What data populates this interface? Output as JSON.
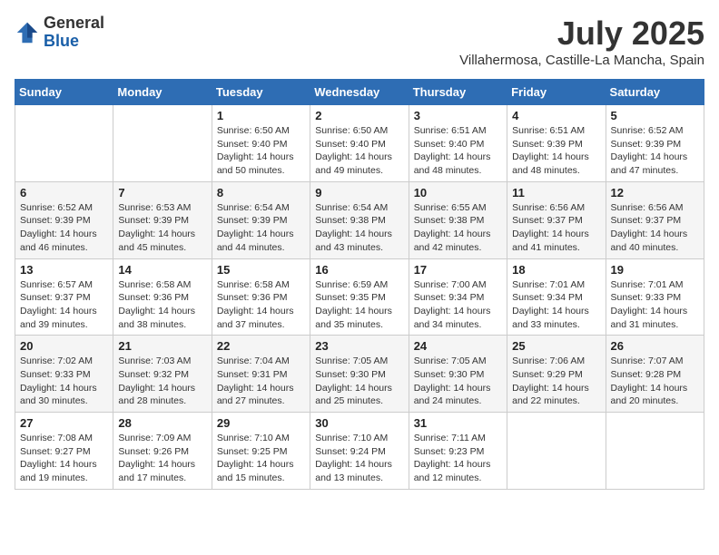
{
  "logo": {
    "general": "General",
    "blue": "Blue"
  },
  "title": "July 2025",
  "subtitle": "Villahermosa, Castille-La Mancha, Spain",
  "days_of_week": [
    "Sunday",
    "Monday",
    "Tuesday",
    "Wednesday",
    "Thursday",
    "Friday",
    "Saturday"
  ],
  "weeks": [
    [
      {
        "num": "",
        "detail": ""
      },
      {
        "num": "",
        "detail": ""
      },
      {
        "num": "1",
        "detail": "Sunrise: 6:50 AM\nSunset: 9:40 PM\nDaylight: 14 hours and 50 minutes."
      },
      {
        "num": "2",
        "detail": "Sunrise: 6:50 AM\nSunset: 9:40 PM\nDaylight: 14 hours and 49 minutes."
      },
      {
        "num": "3",
        "detail": "Sunrise: 6:51 AM\nSunset: 9:40 PM\nDaylight: 14 hours and 48 minutes."
      },
      {
        "num": "4",
        "detail": "Sunrise: 6:51 AM\nSunset: 9:39 PM\nDaylight: 14 hours and 48 minutes."
      },
      {
        "num": "5",
        "detail": "Sunrise: 6:52 AM\nSunset: 9:39 PM\nDaylight: 14 hours and 47 minutes."
      }
    ],
    [
      {
        "num": "6",
        "detail": "Sunrise: 6:52 AM\nSunset: 9:39 PM\nDaylight: 14 hours and 46 minutes."
      },
      {
        "num": "7",
        "detail": "Sunrise: 6:53 AM\nSunset: 9:39 PM\nDaylight: 14 hours and 45 minutes."
      },
      {
        "num": "8",
        "detail": "Sunrise: 6:54 AM\nSunset: 9:39 PM\nDaylight: 14 hours and 44 minutes."
      },
      {
        "num": "9",
        "detail": "Sunrise: 6:54 AM\nSunset: 9:38 PM\nDaylight: 14 hours and 43 minutes."
      },
      {
        "num": "10",
        "detail": "Sunrise: 6:55 AM\nSunset: 9:38 PM\nDaylight: 14 hours and 42 minutes."
      },
      {
        "num": "11",
        "detail": "Sunrise: 6:56 AM\nSunset: 9:37 PM\nDaylight: 14 hours and 41 minutes."
      },
      {
        "num": "12",
        "detail": "Sunrise: 6:56 AM\nSunset: 9:37 PM\nDaylight: 14 hours and 40 minutes."
      }
    ],
    [
      {
        "num": "13",
        "detail": "Sunrise: 6:57 AM\nSunset: 9:37 PM\nDaylight: 14 hours and 39 minutes."
      },
      {
        "num": "14",
        "detail": "Sunrise: 6:58 AM\nSunset: 9:36 PM\nDaylight: 14 hours and 38 minutes."
      },
      {
        "num": "15",
        "detail": "Sunrise: 6:58 AM\nSunset: 9:36 PM\nDaylight: 14 hours and 37 minutes."
      },
      {
        "num": "16",
        "detail": "Sunrise: 6:59 AM\nSunset: 9:35 PM\nDaylight: 14 hours and 35 minutes."
      },
      {
        "num": "17",
        "detail": "Sunrise: 7:00 AM\nSunset: 9:34 PM\nDaylight: 14 hours and 34 minutes."
      },
      {
        "num": "18",
        "detail": "Sunrise: 7:01 AM\nSunset: 9:34 PM\nDaylight: 14 hours and 33 minutes."
      },
      {
        "num": "19",
        "detail": "Sunrise: 7:01 AM\nSunset: 9:33 PM\nDaylight: 14 hours and 31 minutes."
      }
    ],
    [
      {
        "num": "20",
        "detail": "Sunrise: 7:02 AM\nSunset: 9:33 PM\nDaylight: 14 hours and 30 minutes."
      },
      {
        "num": "21",
        "detail": "Sunrise: 7:03 AM\nSunset: 9:32 PM\nDaylight: 14 hours and 28 minutes."
      },
      {
        "num": "22",
        "detail": "Sunrise: 7:04 AM\nSunset: 9:31 PM\nDaylight: 14 hours and 27 minutes."
      },
      {
        "num": "23",
        "detail": "Sunrise: 7:05 AM\nSunset: 9:30 PM\nDaylight: 14 hours and 25 minutes."
      },
      {
        "num": "24",
        "detail": "Sunrise: 7:05 AM\nSunset: 9:30 PM\nDaylight: 14 hours and 24 minutes."
      },
      {
        "num": "25",
        "detail": "Sunrise: 7:06 AM\nSunset: 9:29 PM\nDaylight: 14 hours and 22 minutes."
      },
      {
        "num": "26",
        "detail": "Sunrise: 7:07 AM\nSunset: 9:28 PM\nDaylight: 14 hours and 20 minutes."
      }
    ],
    [
      {
        "num": "27",
        "detail": "Sunrise: 7:08 AM\nSunset: 9:27 PM\nDaylight: 14 hours and 19 minutes."
      },
      {
        "num": "28",
        "detail": "Sunrise: 7:09 AM\nSunset: 9:26 PM\nDaylight: 14 hours and 17 minutes."
      },
      {
        "num": "29",
        "detail": "Sunrise: 7:10 AM\nSunset: 9:25 PM\nDaylight: 14 hours and 15 minutes."
      },
      {
        "num": "30",
        "detail": "Sunrise: 7:10 AM\nSunset: 9:24 PM\nDaylight: 14 hours and 13 minutes."
      },
      {
        "num": "31",
        "detail": "Sunrise: 7:11 AM\nSunset: 9:23 PM\nDaylight: 14 hours and 12 minutes."
      },
      {
        "num": "",
        "detail": ""
      },
      {
        "num": "",
        "detail": ""
      }
    ]
  ]
}
